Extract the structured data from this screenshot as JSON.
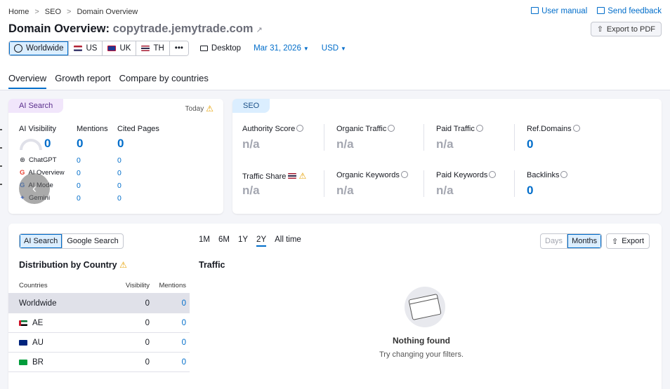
{
  "breadcrumbs": [
    "Home",
    "SEO",
    "Domain Overview"
  ],
  "top_links": {
    "manual": "User manual",
    "feedback": "Send feedback"
  },
  "title": {
    "prefix": "Domain Overview:",
    "domain": "copytrade.jemytrade.com"
  },
  "export_pdf": "Export to PDF",
  "databases": [
    {
      "label": "Worldwide",
      "active": true
    },
    {
      "label": "US"
    },
    {
      "label": "UK"
    },
    {
      "label": "TH"
    },
    {
      "label": "•••"
    }
  ],
  "device": "Desktop",
  "date": "Mar 31, 2026",
  "currency": "USD",
  "tabs": [
    "Overview",
    "Growth report",
    "Compare by countries"
  ],
  "ai_card": {
    "pill": "AI Search",
    "today": "Today",
    "metrics": [
      {
        "label": "AI Visibility",
        "value": "0"
      },
      {
        "label": "Mentions",
        "value": "0"
      },
      {
        "label": "Cited Pages",
        "value": "0"
      }
    ],
    "sources": [
      {
        "name": "ChatGPT",
        "mentions": "0",
        "cited": "0"
      },
      {
        "name": "AI Overview",
        "mentions": "0",
        "cited": "0"
      },
      {
        "name": "AI Mode",
        "mentions": "0",
        "cited": "0"
      },
      {
        "name": "Gemini",
        "mentions": "0",
        "cited": "0"
      }
    ]
  },
  "seo_card": {
    "pill": "SEO",
    "row1": [
      {
        "label": "Authority Score",
        "value": "n/a"
      },
      {
        "label": "Organic Traffic",
        "value": "n/a"
      },
      {
        "label": "Paid Traffic",
        "value": "n/a"
      },
      {
        "label": "Ref.Domains",
        "value": "0"
      }
    ],
    "row2": [
      {
        "label": "Traffic Share",
        "value": "n/a"
      },
      {
        "label": "Organic Keywords",
        "value": "n/a"
      },
      {
        "label": "Paid Keywords",
        "value": "n/a"
      },
      {
        "label": "Backlinks",
        "value": "0"
      }
    ]
  },
  "bottom": {
    "source_toggle": [
      "AI Search",
      "Google Search"
    ],
    "periods": [
      "1M",
      "6M",
      "1Y",
      "2Y",
      "All time"
    ],
    "selected_period": "2Y",
    "granularity": [
      "Days",
      "Months"
    ],
    "export": "Export",
    "dist_title": "Distribution by Country",
    "traffic_title": "Traffic",
    "table_headers": [
      "Countries",
      "Visibility",
      "Mentions"
    ],
    "rows": [
      {
        "country": "Worldwide",
        "visibility": "0",
        "mentions": "0"
      },
      {
        "country": "AE",
        "visibility": "0",
        "mentions": "0"
      },
      {
        "country": "AU",
        "visibility": "0",
        "mentions": "0"
      },
      {
        "country": "BR",
        "visibility": "0",
        "mentions": "0"
      }
    ],
    "empty_title": "Nothing found",
    "empty_sub": "Try changing your filters."
  },
  "colors": {
    "accent": "#006dca",
    "muted": "#a3a6b0",
    "warning": "#e6a000"
  }
}
